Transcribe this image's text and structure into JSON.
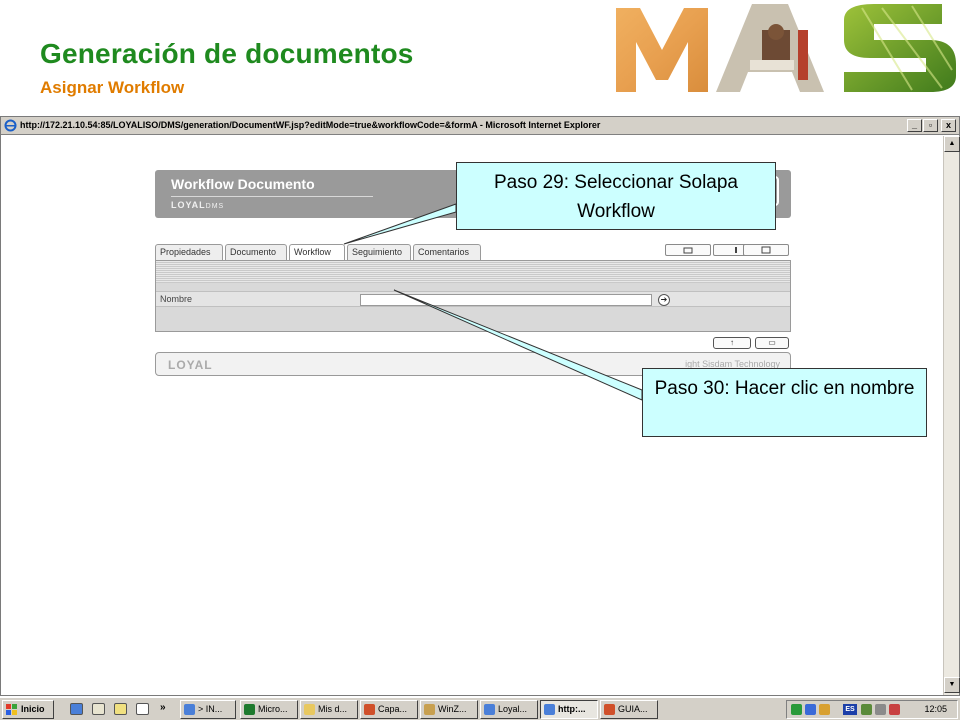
{
  "slide": {
    "title": "Generación de documentos",
    "subtitle": "Asignar Workflow",
    "title_color": "#1f8a1f",
    "subtitle_color": "#e07c00"
  },
  "browser": {
    "window_title": "http://172.21.10.54:85/LOYALISO/DMS/generation/DocumentWF.jsp?editMode=true&workflowCode=&formA - Microsoft Internet Explorer",
    "minimize_label": "_",
    "maximize_label": "▫",
    "close_label": "x"
  },
  "app": {
    "panel_title": "Workflow Documento",
    "logo_text": "LOYAL",
    "logo_suffix": "DMS",
    "tabs": [
      {
        "label": "Propiedades",
        "active": false
      },
      {
        "label": "Documento",
        "active": false
      },
      {
        "label": "Workflow",
        "active": true
      },
      {
        "label": "Seguimiento",
        "active": false
      },
      {
        "label": "Comentarios",
        "active": false
      }
    ],
    "name_label": "Nombre",
    "name_value": "",
    "go_icon_glyph": "➔",
    "up_button_glyph": "↑",
    "save_button_glyph": "▭",
    "footer_logo": "LOYAL",
    "footer_copyright": "ight Sisdam Technology"
  },
  "callouts": {
    "step29": "Paso 29: Seleccionar Solapa Workflow",
    "step30": "Paso 30: Hacer clic en nombre",
    "fill_color": "#ccffff"
  },
  "taskbar": {
    "start_label": "Inicio",
    "quick_launch_more": "»",
    "tasks": [
      {
        "label": "> IN...",
        "icon": "ie-icon",
        "active": false
      },
      {
        "label": "Micro...",
        "icon": "excel-icon",
        "active": false
      },
      {
        "label": "Mis d...",
        "icon": "folder-icon",
        "active": false
      },
      {
        "label": "Capa...",
        "icon": "powerpoint-icon",
        "active": false
      },
      {
        "label": "WinZ...",
        "icon": "winzip-icon",
        "active": false
      },
      {
        "label": "Loyal...",
        "icon": "ie-icon",
        "active": false
      },
      {
        "label": "http:...",
        "icon": "ie-icon",
        "active": true
      },
      {
        "label": "GUIA...",
        "icon": "powerpoint-icon",
        "active": false
      }
    ],
    "language": "ES",
    "clock": "12:05"
  }
}
